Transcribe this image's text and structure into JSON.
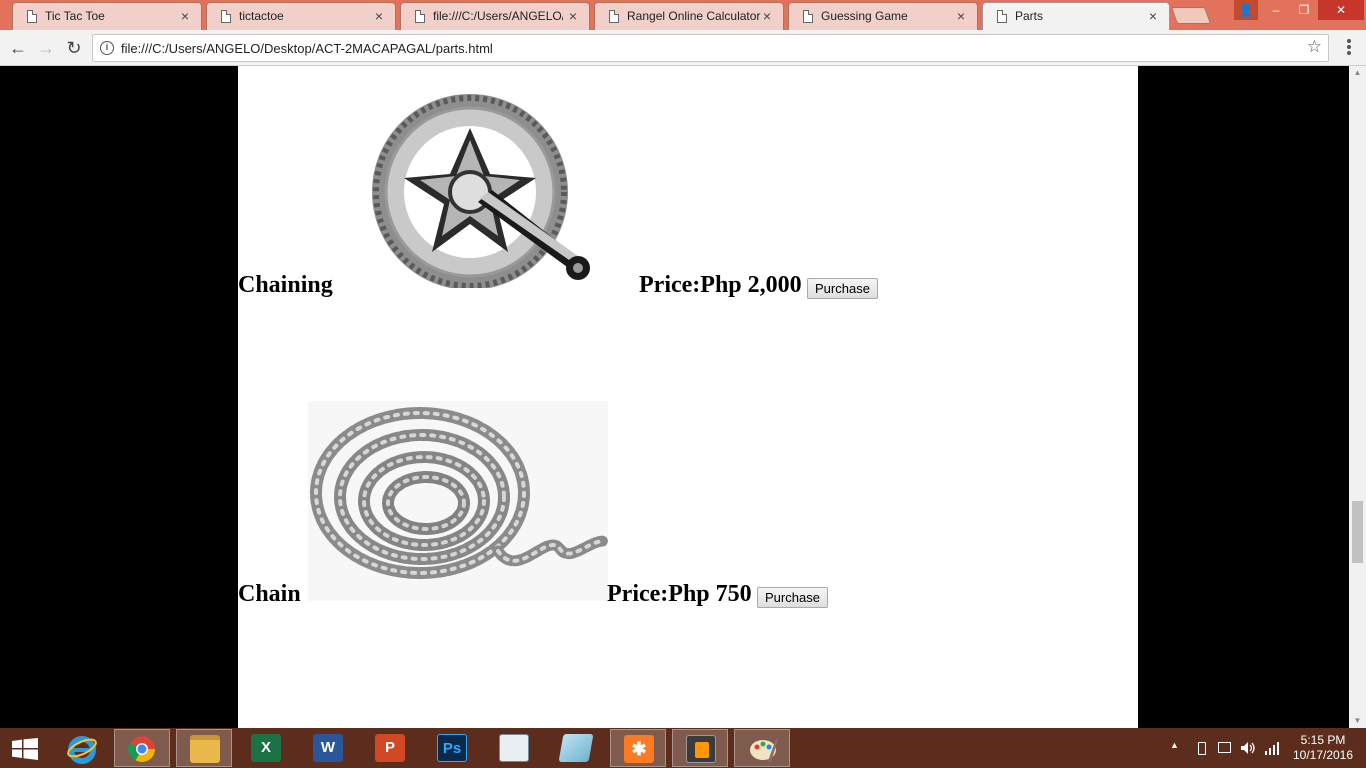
{
  "browser": {
    "tabs": [
      {
        "label": "Tic Tac Toe",
        "active": false
      },
      {
        "label": "tictactoe",
        "active": false
      },
      {
        "label": "file:///C:/Users/ANGELO/",
        "active": false
      },
      {
        "label": "Rangel Online Calculator",
        "active": false
      },
      {
        "label": "Guessing Game",
        "active": false
      },
      {
        "label": "Parts",
        "active": true
      }
    ],
    "close_glyph": "×",
    "url": "file:///C:/Users/ANGELO/Desktop/ACT-2MACAPAGAL/parts.html",
    "back_glyph": "←",
    "forward_glyph": "→",
    "reload_glyph": "↻",
    "info_glyph": "i",
    "star_glyph": "☆",
    "window_controls": {
      "minimize": "–",
      "restore": "❐",
      "close": "✕",
      "profile": "👤"
    }
  },
  "parts": [
    {
      "name": "Chaining",
      "price": "Price:Php 2,000",
      "button": "Purchase",
      "image": "crankset-image"
    },
    {
      "name": "Chain",
      "price": "Price:Php 750",
      "button": "Purchase",
      "image": "bike-chain-image"
    }
  ],
  "scrollbar": {
    "up": "▲",
    "down": "▼"
  },
  "taskbar": {
    "apps": [
      "start",
      "internet-explorer",
      "chrome",
      "file-explorer",
      "excel",
      "word",
      "powerpoint",
      "photoshop",
      "mysql-installer",
      "notepad",
      "xampp",
      "sublime-text",
      "paint"
    ],
    "app_letters": {
      "excel": "X",
      "word": "W",
      "powerpoint": "P",
      "photoshop": "Ps",
      "xampp": "✱"
    },
    "tray": {
      "arrow": "▲"
    },
    "time": "5:15 PM",
    "date": "10/17/2016"
  }
}
